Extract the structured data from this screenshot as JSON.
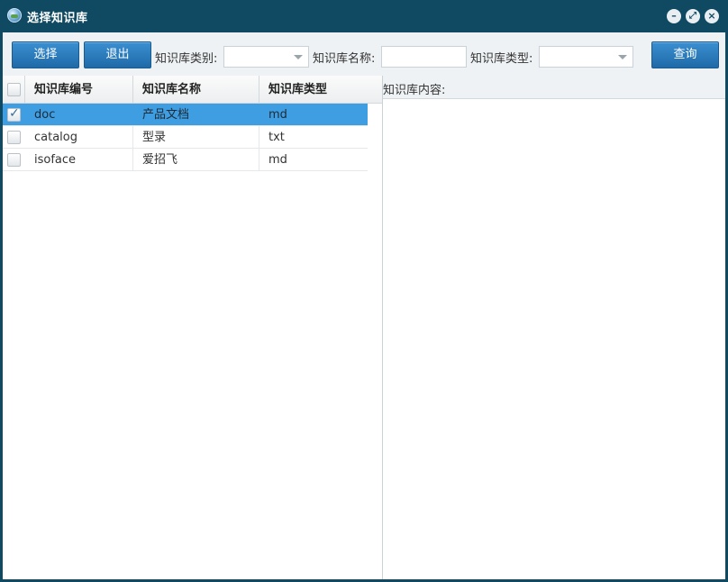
{
  "window": {
    "title": "选择知识库"
  },
  "toolbar": {
    "select_label": "选择",
    "exit_label": "退出",
    "category_label": "知识库类别:",
    "category_value": "",
    "name_label": "知识库名称:",
    "name_value": "",
    "type_label": "知识库类型:",
    "type_value": "",
    "query_label": "查询"
  },
  "grid": {
    "columns": [
      "知识库编号",
      "知识库名称",
      "知识库类型"
    ],
    "rows": [
      {
        "id": "doc",
        "name": "产品文档",
        "type": "md",
        "checked": true,
        "selected": true
      },
      {
        "id": "catalog",
        "name": "型录",
        "type": "txt",
        "checked": false,
        "selected": false
      },
      {
        "id": "isoface",
        "name": "爱招飞",
        "type": "md",
        "checked": false,
        "selected": false
      }
    ]
  },
  "content_panel": {
    "label": "知识库内容:"
  },
  "colors": {
    "titlebar": "#0f4a62",
    "accent": "#2a7dc0",
    "selected_row": "#3f9ee2"
  }
}
